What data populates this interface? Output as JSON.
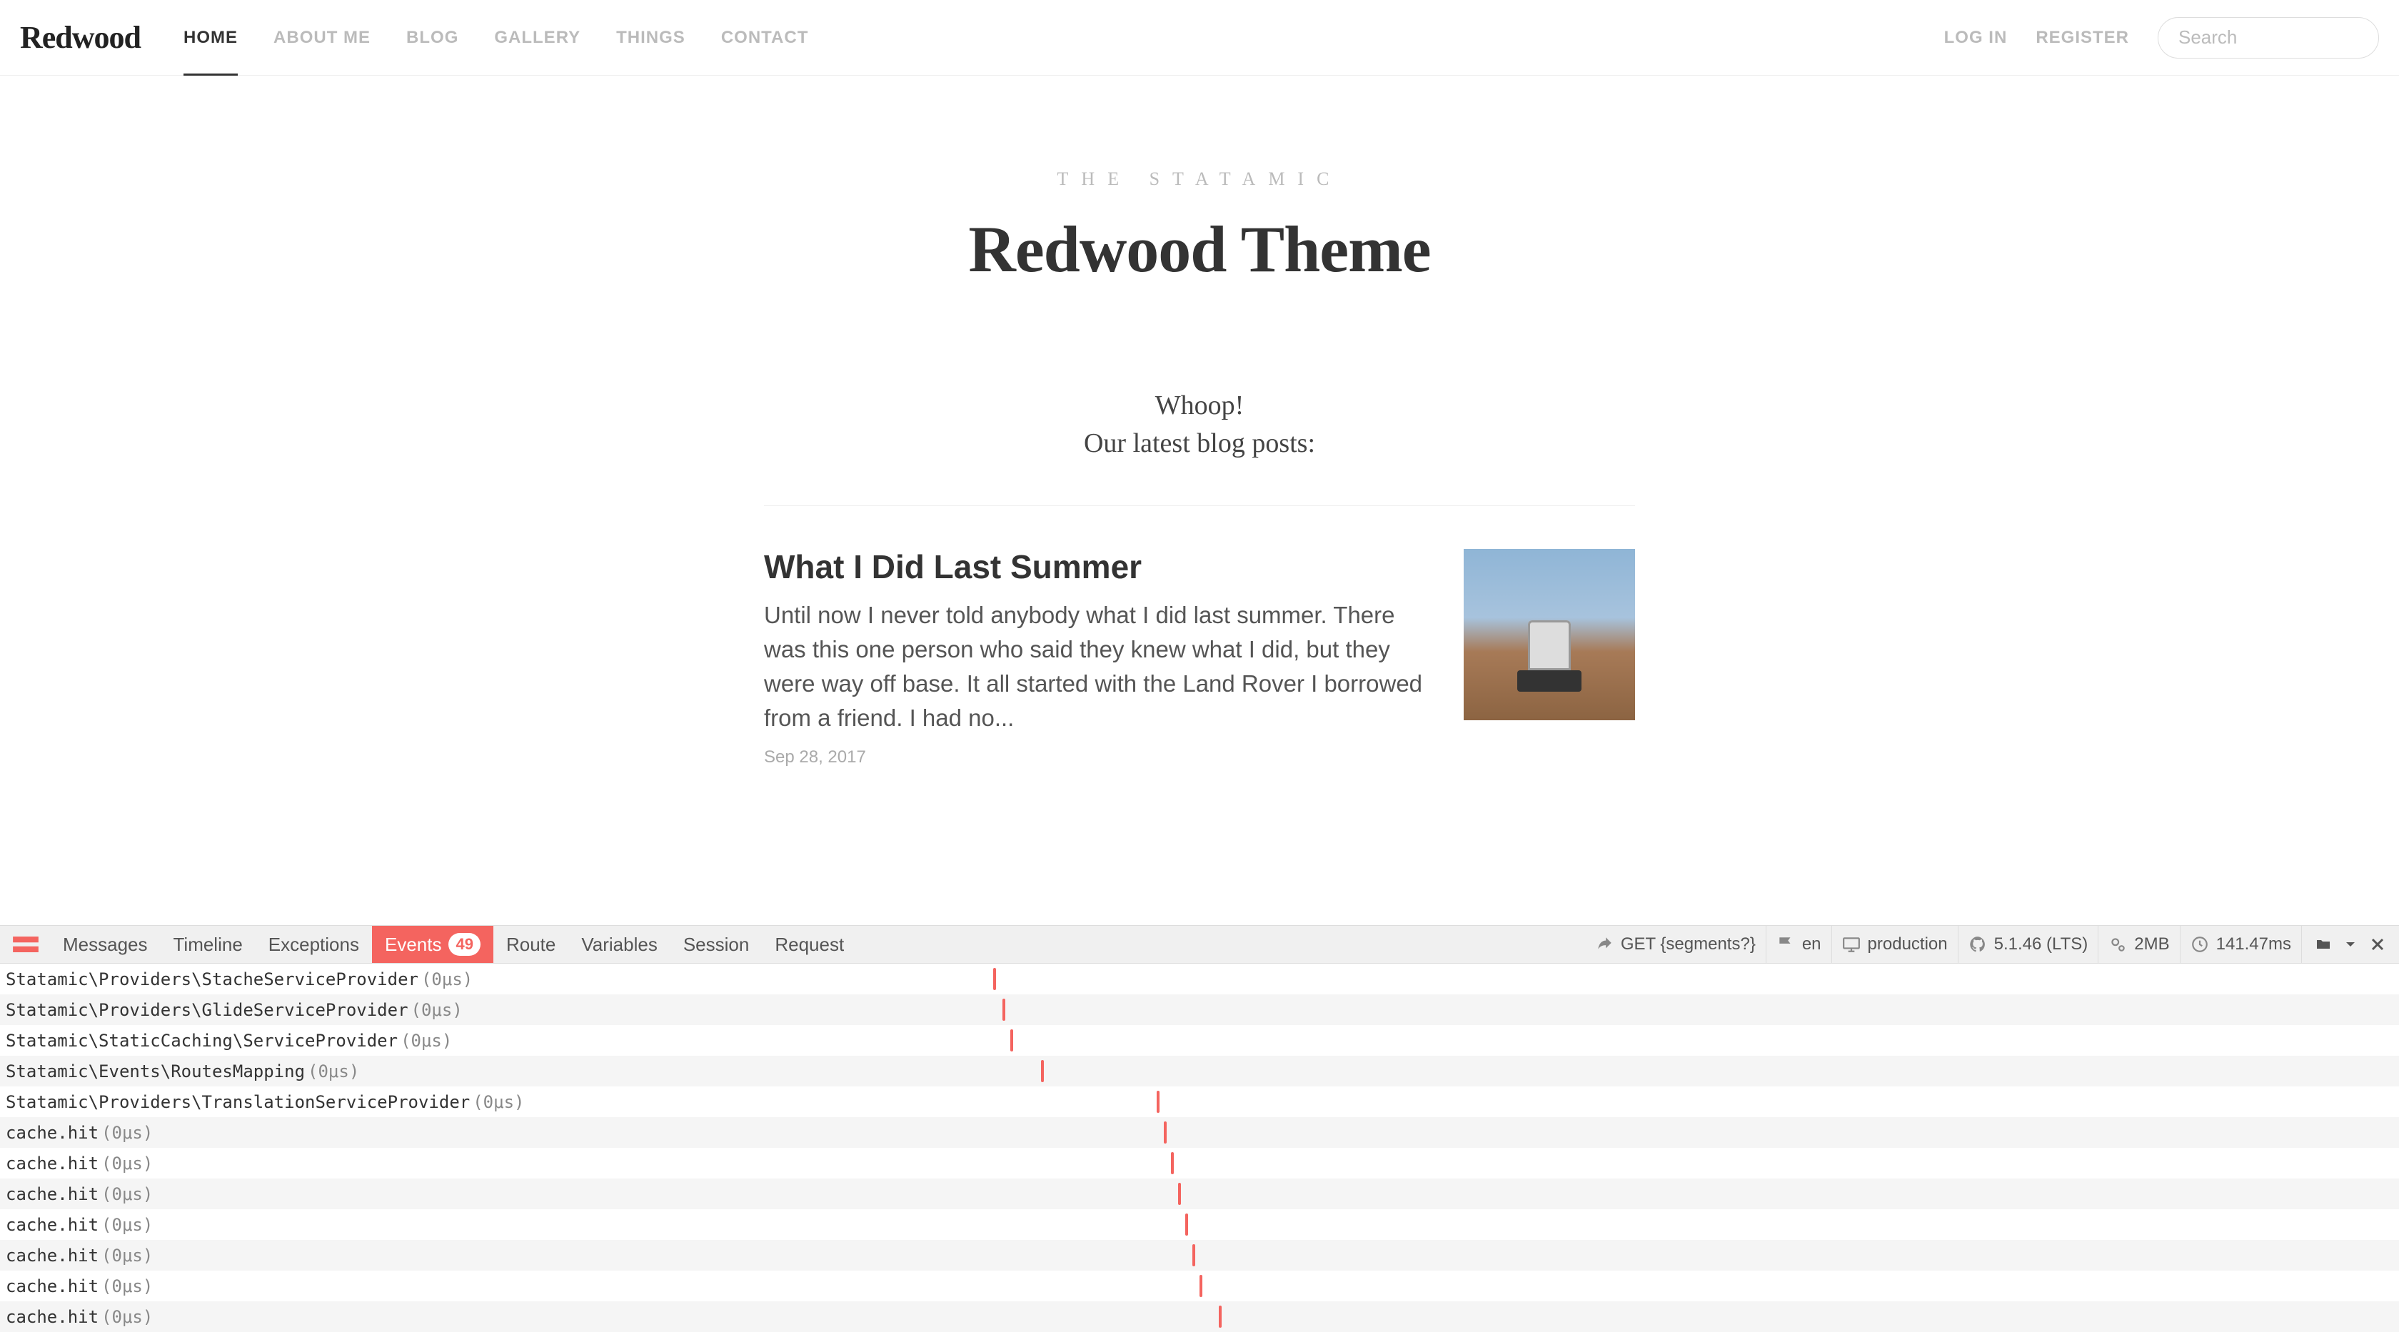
{
  "brand": "Redwood",
  "nav": {
    "items": [
      {
        "label": "HOME",
        "active": true
      },
      {
        "label": "ABOUT ME",
        "active": false
      },
      {
        "label": "BLOG",
        "active": false
      },
      {
        "label": "GALLERY",
        "active": false
      },
      {
        "label": "THINGS",
        "active": false
      },
      {
        "label": "CONTACT",
        "active": false
      }
    ]
  },
  "auth": {
    "login": "LOG IN",
    "register": "REGISTER"
  },
  "search": {
    "placeholder": "Search"
  },
  "hero": {
    "eyebrow": "THE STATAMIC",
    "title": "Redwood Theme"
  },
  "intro": {
    "line1": "Whoop!",
    "line2": "Our latest blog posts:"
  },
  "post": {
    "title": "What I Did Last Summer",
    "excerpt": "Until now I never told anybody what I did last summer. There was this one person who said they knew what I did, but they were way off base. It all started with the Land Rover I borrowed from a friend. I had no...",
    "date": "Sep 28, 2017"
  },
  "debug": {
    "tabs": {
      "messages": "Messages",
      "timeline": "Timeline",
      "exceptions": "Exceptions",
      "events": "Events",
      "events_badge": "49",
      "route": "Route",
      "variables": "Variables",
      "session": "Session",
      "request": "Request"
    },
    "stats": {
      "method": "GET {segments?}",
      "locale": "en",
      "env": "production",
      "version": "5.1.46 (LTS)",
      "memory": "2MB",
      "time": "141.47ms"
    },
    "events": [
      {
        "name": "Statamic\\Providers\\StacheServiceProvider",
        "time": "(0μs)",
        "tick_pct": 41.4
      },
      {
        "name": "Statamic\\Providers\\GlideServiceProvider",
        "time": "(0μs)",
        "tick_pct": 41.8
      },
      {
        "name": "Statamic\\StaticCaching\\ServiceProvider",
        "time": "(0μs)",
        "tick_pct": 42.1
      },
      {
        "name": "Statamic\\Events\\RoutesMapping",
        "time": "(0μs)",
        "tick_pct": 43.4
      },
      {
        "name": "Statamic\\Providers\\TranslationServiceProvider",
        "time": "(0μs)",
        "tick_pct": 48.2
      },
      {
        "name": "cache.hit",
        "time": "(0μs)",
        "tick_pct": 48.5
      },
      {
        "name": "cache.hit",
        "time": "(0μs)",
        "tick_pct": 48.8
      },
      {
        "name": "cache.hit",
        "time": "(0μs)",
        "tick_pct": 49.1
      },
      {
        "name": "cache.hit",
        "time": "(0μs)",
        "tick_pct": 49.4
      },
      {
        "name": "cache.hit",
        "time": "(0μs)",
        "tick_pct": 49.7
      },
      {
        "name": "cache.hit",
        "time": "(0μs)",
        "tick_pct": 50.0
      },
      {
        "name": "cache.hit",
        "time": "(0μs)",
        "tick_pct": 50.8
      }
    ]
  }
}
